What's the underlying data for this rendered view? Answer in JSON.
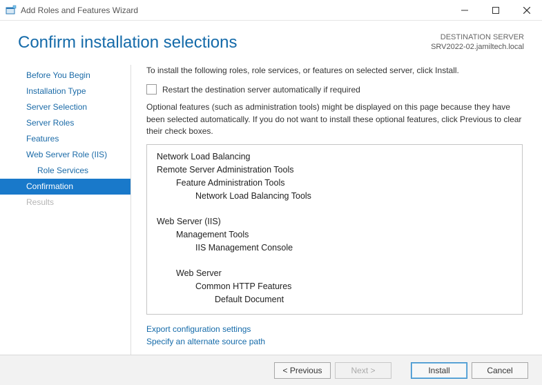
{
  "window": {
    "title": "Add Roles and Features Wizard"
  },
  "header": {
    "page_title": "Confirm installation selections",
    "destination_label": "DESTINATION SERVER",
    "destination_server": "SRV2022-02.jamiltech.local"
  },
  "sidebar": {
    "items": [
      {
        "label": "Before You Begin",
        "state": "normal",
        "indent": 0
      },
      {
        "label": "Installation Type",
        "state": "normal",
        "indent": 0
      },
      {
        "label": "Server Selection",
        "state": "normal",
        "indent": 0
      },
      {
        "label": "Server Roles",
        "state": "normal",
        "indent": 0
      },
      {
        "label": "Features",
        "state": "normal",
        "indent": 0
      },
      {
        "label": "Web Server Role (IIS)",
        "state": "normal",
        "indent": 0
      },
      {
        "label": "Role Services",
        "state": "normal",
        "indent": 1
      },
      {
        "label": "Confirmation",
        "state": "active",
        "indent": 0
      },
      {
        "label": "Results",
        "state": "disabled",
        "indent": 0
      }
    ]
  },
  "content": {
    "instruction": "To install the following roles, role services, or features on selected server, click Install.",
    "restart_checkbox_label": "Restart the destination server automatically if required",
    "restart_checked": false,
    "optional_note": "Optional features (such as administration tools) might be displayed on this page because they have been selected automatically. If you do not want to install these optional features, click Previous to clear their check boxes.",
    "selections": [
      {
        "indent": 0,
        "label": "Network Load Balancing"
      },
      {
        "indent": 0,
        "label": "Remote Server Administration Tools"
      },
      {
        "indent": 1,
        "label": "Feature Administration Tools"
      },
      {
        "indent": 2,
        "label": "Network Load Balancing Tools"
      },
      {
        "indent": 0,
        "label": ""
      },
      {
        "indent": 0,
        "label": "Web Server (IIS)"
      },
      {
        "indent": 1,
        "label": "Management Tools"
      },
      {
        "indent": 2,
        "label": "IIS Management Console"
      },
      {
        "indent": 0,
        "label": ""
      },
      {
        "indent": 1,
        "label": "Web Server"
      },
      {
        "indent": 2,
        "label": "Common HTTP Features"
      },
      {
        "indent": 3,
        "label": "Default Document"
      }
    ],
    "links": {
      "export": "Export configuration settings",
      "alt_source": "Specify an alternate source path"
    }
  },
  "footer": {
    "previous": "< Previous",
    "next": "Next >",
    "install": "Install",
    "cancel": "Cancel"
  }
}
